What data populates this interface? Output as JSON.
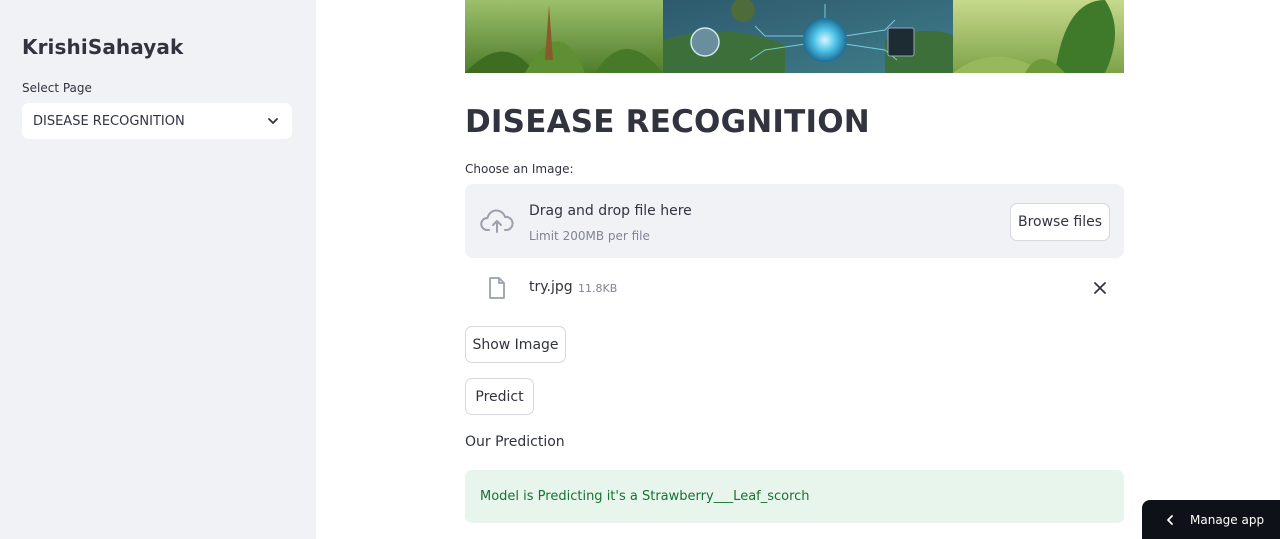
{
  "sidebar": {
    "brand": "KrishiSahayak",
    "select_label": "Select Page",
    "select_value": "DISEASE RECOGNITION"
  },
  "main": {
    "page_title": "DISEASE RECOGNITION",
    "uploader": {
      "label": "Choose an Image:",
      "drop_text": "Drag and drop file here",
      "limit_text": "Limit 200MB per file",
      "browse_label": "Browse files"
    },
    "file": {
      "name": "try.jpg",
      "size": "11.8KB"
    },
    "show_image_label": "Show Image",
    "predict_label": "Predict",
    "prediction_heading": "Our Prediction",
    "prediction_message": "Model is Predicting it's a Strawberry___Leaf_scorch"
  },
  "footer": {
    "manage_app_label": "Manage app"
  },
  "colors": {
    "sidebar_bg": "#f0f2f6",
    "text": "#31333f",
    "success_bg": "#e8f5ec",
    "success_text": "#177233",
    "manage_bg": "#0e1117"
  }
}
